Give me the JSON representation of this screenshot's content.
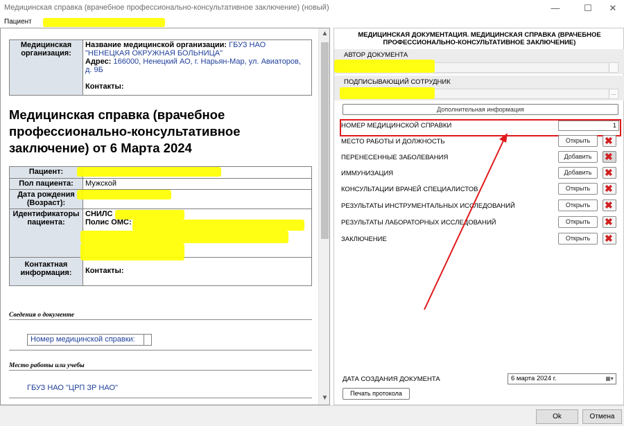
{
  "window": {
    "title": "Медицинская справка (врачебное профессионально-консультативное заключение) (новый)",
    "minimize": "—",
    "maximize": "☐",
    "close": "✕"
  },
  "menu": {
    "patient": "Пациент"
  },
  "document": {
    "org": {
      "label": "Медицинская организация:",
      "name_label": "Название медицинской организации:",
      "name_value": "ГБУЗ НАО \"НЕНЕЦКАЯ ОКРУЖНАЯ БОЛЬНИЦА\"",
      "address_label": "Адрес:",
      "address_value": "166000, Ненецкий АО, г. Нарьян-Мар, ул. Авиаторов, д. 9Б",
      "contacts_label": "Контакты:"
    },
    "title": "Медицинская справка (врачебное профессионально-консультативное заключение) от 6 Марта 2024",
    "patient": {
      "patient_label": "Пациент:",
      "gender_label": "Пол пациента:",
      "gender_value": "Мужской",
      "dob_label": "Дата рождения (Возраст):",
      "ids_label": "Идентификаторы пациента:",
      "snils_label": "СНИЛС",
      "oms_label": "Полис ОМС:",
      "contact_label": "Контактная информация:",
      "contacts_label": "Контакты:"
    },
    "section_doc_info": "Сведения о документе",
    "doc_number_label": "Номер медицинской справки:",
    "section_work": "Место работы или учебы",
    "work_value": "ГБУЗ НАО \"ЦРП ЗР НАО\""
  },
  "panel": {
    "header": "МЕДИЦИНСКАЯ ДОКУМЕНТАЦИЯ. МЕДИЦИНСКАЯ СПРАВКА (ВРАЧЕБНОЕ ПРОФЕССИОНАЛЬНО-КОНСУЛЬТАТИВНОЕ ЗАКЛЮЧЕНИЕ)",
    "author_label": "АВТОР ДОКУМЕНТА",
    "signer_label": "ПОДПИСЫВАЮЩИЙ СОТРУДНИК",
    "dots": "...",
    "additional_info": "Дополнительная информация",
    "cert_number_label": "НОМЕР МЕДИЦИНСКОЙ СПРАВКИ",
    "cert_number_value": "1",
    "rows": [
      {
        "label": "МЕСТО РАБОТЫ И ДОЛЖНОСТЬ",
        "button": "Открыть"
      },
      {
        "label": "ПЕРЕНЕСЕННЫЕ ЗАБОЛЕВАНИЯ",
        "button": "Добавить"
      },
      {
        "label": "ИММУНИЗАЦИЯ",
        "button": "Добавить"
      },
      {
        "label": "КОНСУЛЬТАЦИИ ВРАЧЕЙ СПЕЦИАЛИСТОВ",
        "button": "Открыть"
      },
      {
        "label": "РЕЗУЛЬТАТЫ ИНСТРУМЕНТАЛЬНЫХ ИССЛЕДОВАНИЙ",
        "button": "Открыть"
      },
      {
        "label": "РЕЗУЛЬТАТЫ ЛАБОРАТОРНЫХ ИССЛЕДОВАНИЙ",
        "button": "Открыть"
      },
      {
        "label": "ЗАКЛЮЧЕНИЕ",
        "button": "Открыть"
      }
    ],
    "creation_date_label": "ДАТА СОЗДАНИЯ ДОКУМЕНТА",
    "creation_date_value": "6   марта   2024 г.",
    "print_button": "Печать протокола"
  },
  "footer": {
    "ok": "Ok",
    "cancel": "Отмена"
  },
  "colors": {
    "annotation_red": "#e0191b",
    "highlight": "#ffff00",
    "link_blue": "#1f3f9a"
  }
}
